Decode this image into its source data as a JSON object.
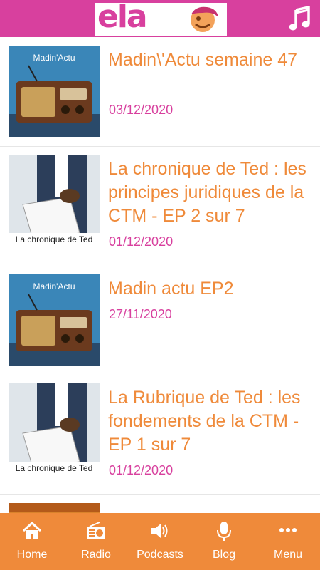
{
  "header": {
    "logo_text": "ela",
    "music_icon": "music-note-icon",
    "brand_color": "#d8409e"
  },
  "posts": [
    {
      "title": "Madin\\'Actu semaine 47",
      "date": "03/12/2020",
      "cover": "madin-actu",
      "cover_label": "Madin'Actu"
    },
    {
      "title": "La chronique de Ted : les principes juridiques de la CTM - EP 2 sur 7",
      "date": "01/12/2020",
      "cover": "ted",
      "cover_label": "La chronique de Ted"
    },
    {
      "title": "Madin actu EP2",
      "date": "27/11/2020",
      "cover": "madin-actu",
      "cover_label": "Madin'Actu"
    },
    {
      "title": "La Rubrique de Ted : les fondements de la CTM - EP 1 sur 7",
      "date": "01/12/2020",
      "cover": "ted",
      "cover_label": "La chronique de Ted"
    }
  ],
  "nav": {
    "accent": "#ef8a3a",
    "items": [
      {
        "label": "Home",
        "icon": "home-icon"
      },
      {
        "label": "Radio",
        "icon": "radio-icon"
      },
      {
        "label": "Podcasts",
        "icon": "speaker-icon"
      },
      {
        "label": "Blog",
        "icon": "microphone-icon"
      },
      {
        "label": "Menu",
        "icon": "more-dots-icon"
      }
    ]
  }
}
